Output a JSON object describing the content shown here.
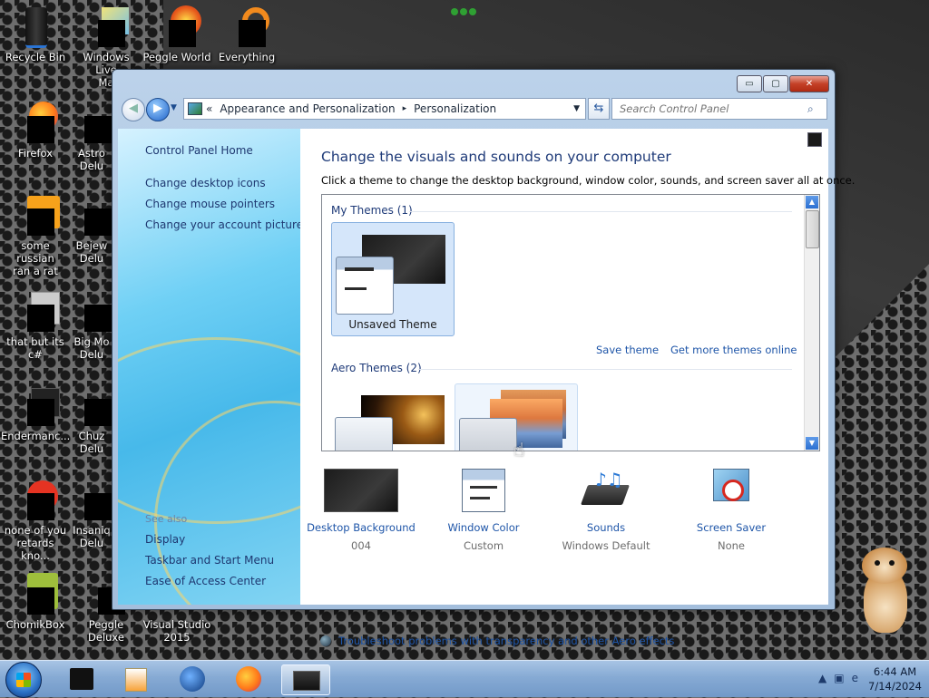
{
  "desktop": {
    "icons": [
      {
        "label": "Recycle Bin"
      },
      {
        "label": "Windows Live\nMa"
      },
      {
        "label": "Peggle World"
      },
      {
        "label": "Everything"
      },
      {
        "label": "Firefox"
      },
      {
        "label": "Astro\nDelu"
      },
      {
        "label": "some russian\nran a rat"
      },
      {
        "label": "Bejew\nDelu"
      },
      {
        "label": "that but its c#"
      },
      {
        "label": "Big Mo\nDelu"
      },
      {
        "label": "Endermanc..."
      },
      {
        "label": "Chuz\nDelu"
      },
      {
        "label": "none of you\nretards kno..."
      },
      {
        "label": "Insaniq\nDelu"
      },
      {
        "label": "ChomikBox"
      },
      {
        "label": "Peggle Deluxe"
      },
      {
        "label": "Visual Studio\n2015"
      }
    ]
  },
  "window": {
    "controls": {
      "minimize": "▭",
      "maximize": "▢",
      "close": "✕"
    },
    "address": {
      "prefix": "«",
      "crumb1": "Appearance and Personalization",
      "separator": "▸",
      "crumb2": "Personalization"
    },
    "search_placeholder": "Search Control Panel",
    "left_pane": {
      "home": "Control Panel Home",
      "links": [
        "Change desktop icons",
        "Change mouse pointers",
        "Change your account picture"
      ],
      "see_also": "See also",
      "see_also_links": [
        "Display",
        "Taskbar and Start Menu",
        "Ease of Access Center"
      ]
    },
    "main": {
      "title": "Change the visuals and sounds on your computer",
      "description": "Click a theme to change the desktop background, window color, sounds, and screen saver all at once.",
      "my_themes_header": "My Themes (1)",
      "unsaved_theme": "Unsaved Theme",
      "save_theme": "Save theme",
      "get_more": "Get more themes online",
      "aero_header": "Aero Themes (2)"
    },
    "bottom": [
      {
        "label": "Desktop Background",
        "sub": "004",
        "icon": "desktop-background-icon"
      },
      {
        "label": "Window Color",
        "sub": "Custom",
        "icon": "window-color-icon"
      },
      {
        "label": "Sounds",
        "sub": "Windows Default",
        "icon": "sounds-icon"
      },
      {
        "label": "Screen Saver",
        "sub": "None",
        "icon": "screen-saver-icon"
      }
    ],
    "troubleshoot": "Troubleshoot problems with transparency and other Aero effects"
  },
  "taskbar": {
    "time": "6:44 AM",
    "date": "7/14/2024"
  }
}
